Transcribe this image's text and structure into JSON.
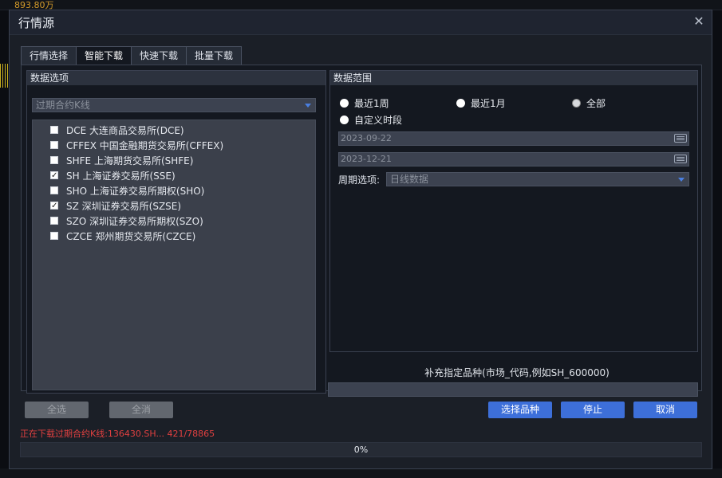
{
  "background": {
    "money_text": "893.80万"
  },
  "dialog": {
    "title": "行情源"
  },
  "tabs": [
    "行情选择",
    "智能下载",
    "快速下载",
    "批量下载"
  ],
  "data_options": {
    "group_title": "数据选项",
    "type_combo": "过期合约K线",
    "markets": [
      {
        "label": "DCE 大连商品交易所(DCE)",
        "checked": false
      },
      {
        "label": "CFFEX 中国金融期货交易所(CFFEX)",
        "checked": false
      },
      {
        "label": "SHFE 上海期货交易所(SHFE)",
        "checked": false
      },
      {
        "label": "SH 上海证券交易所(SSE)",
        "checked": true
      },
      {
        "label": "SHO 上海证券交易所期权(SHO)",
        "checked": false
      },
      {
        "label": "SZ 深圳证券交易所(SZSE)",
        "checked": true
      },
      {
        "label": "SZO 深圳证券交易所期权(SZO)",
        "checked": false
      },
      {
        "label": "CZCE 郑州期货交易所(CZCE)",
        "checked": false
      }
    ]
  },
  "data_range": {
    "group_title": "数据范围",
    "radio_last_week": "最近1周",
    "radio_last_month": "最近1月",
    "radio_all": "全部",
    "radio_custom": "自定义时段",
    "start_date": "2023-09-22",
    "end_date": "2023-12-21",
    "period_label": "周期选项:",
    "period_value": "日线数据"
  },
  "supplement": {
    "hint": "补充指定品种(市场_代码,例如SH_600000)",
    "value": ""
  },
  "buttons": {
    "select_all": "全选",
    "clear_all": "全消",
    "choose_symbols": "选择品种",
    "stop": "停止",
    "cancel": "取消"
  },
  "status": {
    "text": "正在下载过期合约K线:136430.SH... 421/78865"
  },
  "progress": {
    "percent_text": "0%",
    "value": 0
  },
  "colors": {
    "accent": "#3d6fd9",
    "status": "#e04040"
  }
}
